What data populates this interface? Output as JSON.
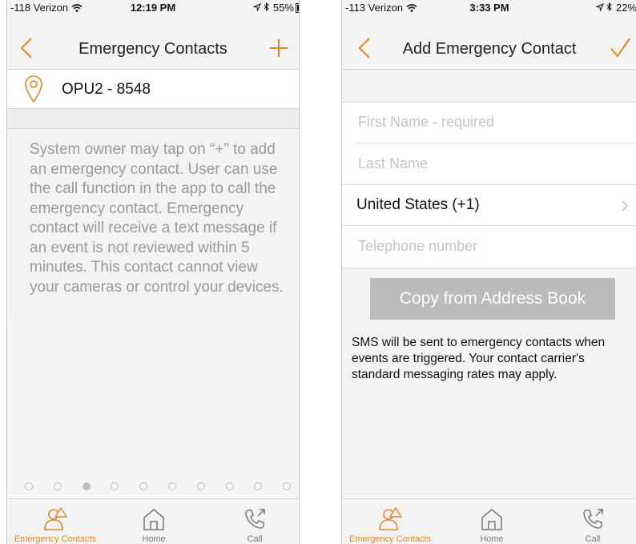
{
  "accent": "#e8861e",
  "left_screen": {
    "status": {
      "carrier": "-118 Verizon",
      "time": "12:19 PM",
      "battery": "55%",
      "battery_level": 0.55
    },
    "nav": {
      "title": "Emergency Contacts",
      "back_icon": "chevron-left-icon",
      "action_icon": "plus-icon"
    },
    "location": {
      "icon": "location-pin-icon",
      "name": "OPU2 - 8548"
    },
    "info_text": "System owner may tap on “+” to add an emergency contact. User can use the call function in the app to call the emergency contact. Emergency contact will receive a text message if an event is not reviewed within 5 minutes. This contact cannot view your cameras or control your devices.",
    "page_dots": {
      "count": 10,
      "active_index": 2
    },
    "tabs": [
      {
        "label": "Emergency Contacts",
        "icon": "person-alert-icon",
        "active": true
      },
      {
        "label": "Home",
        "icon": "home-icon",
        "active": false
      },
      {
        "label": "Call",
        "icon": "phone-call-icon",
        "active": false
      }
    ]
  },
  "right_screen": {
    "status": {
      "carrier": "-113 Verizon",
      "time": "3:33 PM",
      "battery": "22%",
      "battery_level": 0.22
    },
    "nav": {
      "title": "Add Emergency Contact",
      "back_icon": "chevron-left-icon",
      "action_icon": "checkmark-icon"
    },
    "form": {
      "first_name": {
        "placeholder": "First Name - required",
        "value": ""
      },
      "last_name": {
        "placeholder": "Last Name",
        "value": ""
      },
      "country": {
        "label": "United States (+1)",
        "icon": "chevron-right-icon"
      },
      "telephone": {
        "placeholder": "Telephone number",
        "value": ""
      }
    },
    "copy_button": "Copy from Address Book",
    "sms_note": "SMS will be sent to emergency contacts when events are triggered. Your contact carrier's standard messaging rates may apply.",
    "tabs": [
      {
        "label": "Emergency Contacts",
        "icon": "person-alert-icon",
        "active": true
      },
      {
        "label": "Home",
        "icon": "home-icon",
        "active": false
      },
      {
        "label": "Call",
        "icon": "phone-call-icon",
        "active": false
      }
    ]
  }
}
